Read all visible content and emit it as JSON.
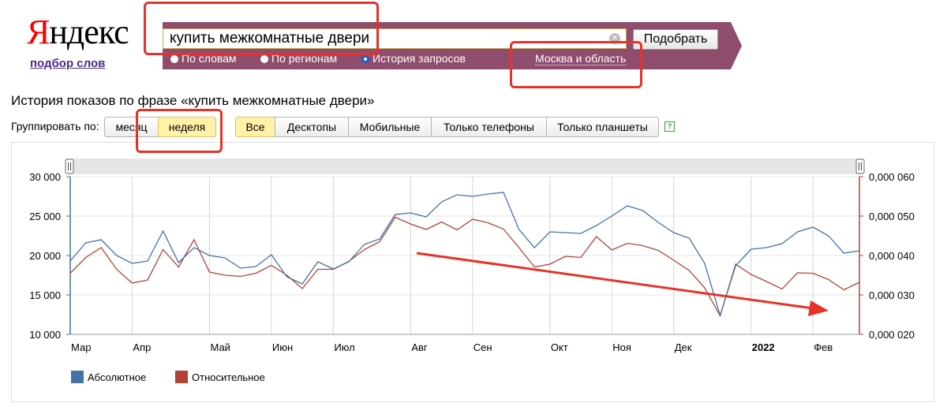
{
  "logo": {
    "first_letter": "Я",
    "rest": "ндекс",
    "sublink": "подбор слов"
  },
  "search": {
    "value": "купить межкомнатные двери",
    "submit_label": "Подобрать"
  },
  "modes": [
    {
      "label": "По словам",
      "selected": false
    },
    {
      "label": "По регионам",
      "selected": false
    },
    {
      "label": "История запросов",
      "selected": true
    }
  ],
  "region_label": "Москва и область",
  "heading": "История показов по фразе «купить межкомнатные двери»",
  "group": {
    "label": "Группировать по:",
    "options": [
      {
        "label": "месяц",
        "selected": false
      },
      {
        "label": "неделя",
        "selected": true
      }
    ]
  },
  "devices": [
    {
      "label": "Все",
      "selected": true
    },
    {
      "label": "Десктопы",
      "selected": false
    },
    {
      "label": "Мобильные",
      "selected": false
    },
    {
      "label": "Только телефоны",
      "selected": false
    },
    {
      "label": "Только планшеты",
      "selected": false
    }
  ],
  "help_icon": "?",
  "colors": {
    "band": "#8f4d6d",
    "absolute": "#4672a8",
    "relative": "#b04438",
    "annotation": "#e53329"
  },
  "chart_data": {
    "type": "line",
    "x": [
      "Мар",
      "",
      "",
      "",
      "Апр",
      "",
      "",
      "",
      "",
      "Май",
      "",
      "",
      "",
      "Июн",
      "",
      "",
      "",
      "Июл",
      "",
      "",
      "",
      "",
      "Авг",
      "",
      "",
      "",
      "Сен",
      "",
      "",
      "",
      "",
      "Окт",
      "",
      "",
      "",
      "Ноя",
      "",
      "",
      "",
      "Дек",
      "",
      "",
      "",
      "",
      "2022",
      "",
      "",
      "",
      "Фев",
      "",
      ""
    ],
    "x_tick_labels": [
      "Мар",
      "Апр",
      "Май",
      "Июн",
      "Июл",
      "Авг",
      "Сен",
      "Окт",
      "Ноя",
      "Дек",
      "2022",
      "Фев"
    ],
    "y_left_ticks": [
      "30 000",
      "25 000",
      "20 000",
      "15 000",
      "10 000"
    ],
    "y_right_ticks": [
      "0,000 060",
      "0,000 050",
      "0,000 040",
      "0,000 030",
      "0,000 020"
    ],
    "ylim_left": [
      10000,
      30000
    ],
    "ylim_right": [
      2e-05,
      6e-05
    ],
    "series": [
      {
        "name": "Абсолютное",
        "axis": "left",
        "values": [
          19300,
          21600,
          22000,
          20000,
          19000,
          19300,
          23100,
          19100,
          21000,
          20000,
          19700,
          18400,
          18600,
          20100,
          17300,
          16400,
          19200,
          18300,
          19200,
          21400,
          22100,
          25200,
          25400,
          24900,
          26800,
          27700,
          27500,
          27800,
          28000,
          23300,
          21000,
          23000,
          22900,
          22800,
          23800,
          25000,
          26300,
          25700,
          24200,
          22900,
          22200,
          19000,
          12400,
          18700,
          20800,
          21000,
          21500,
          23000,
          23600,
          22500,
          20300,
          20600
        ]
      },
      {
        "name": "Относительное",
        "axis": "right",
        "values": [
          3.55e-05,
          3.95e-05,
          4.2e-05,
          3.65e-05,
          3.3e-05,
          3.38e-05,
          4.15e-05,
          3.71e-05,
          4.4e-05,
          3.58e-05,
          3.5e-05,
          3.47e-05,
          3.55e-05,
          3.75e-05,
          3.5e-05,
          3.16e-05,
          3.65e-05,
          3.65e-05,
          3.85e-05,
          4.15e-05,
          4.35e-05,
          4.97e-05,
          4.8e-05,
          4.66e-05,
          4.85e-05,
          4.65e-05,
          4.92e-05,
          4.83e-05,
          4.67e-05,
          4.2e-05,
          3.71e-05,
          3.78e-05,
          3.98e-05,
          3.95e-05,
          4.48e-05,
          4.14e-05,
          4.31e-05,
          4.25e-05,
          4.13e-05,
          3.88e-05,
          3.62e-05,
          3.18e-05,
          2.47e-05,
          3.78e-05,
          3.52e-05,
          3.34e-05,
          3.15e-05,
          3.56e-05,
          3.55e-05,
          3.39e-05,
          3.13e-05,
          3.32e-05
        ]
      }
    ],
    "legend": "bottom-left",
    "grid": true
  }
}
